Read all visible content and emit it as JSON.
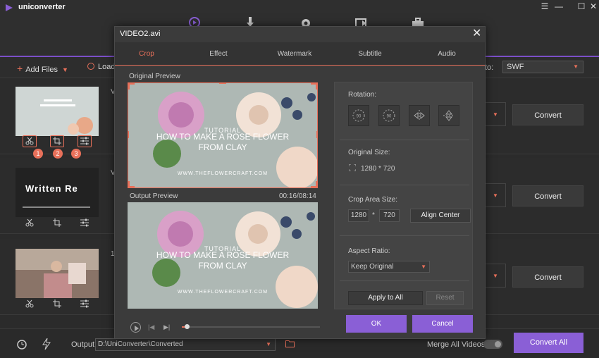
{
  "app": {
    "title": "uniconverter",
    "window_controls": [
      "☰",
      "—",
      "☐",
      "✕"
    ]
  },
  "toolbar": {
    "add_files": "Add Files",
    "load_dvd": "Load",
    "convert_to_label": "to:",
    "format": "SWF"
  },
  "files": [
    {
      "letter": "V",
      "thumb_text": "",
      "convert_label": "Convert",
      "badges": [
        "1",
        "2",
        "3"
      ]
    },
    {
      "letter": "V",
      "thumb_text": "Written Re",
      "convert_label": "Convert"
    },
    {
      "letter": "1",
      "thumb_text": "",
      "convert_label": "Convert"
    }
  ],
  "footer": {
    "output_label": "Output",
    "output_path": "D:\\UniConverter\\Converted",
    "merge_label": "Merge All Videos",
    "convert_all": "Convert All"
  },
  "dialog": {
    "title": "VIDEO2.avi",
    "tabs": [
      "Crop",
      "Effect",
      "Watermark",
      "Subtitle",
      "Audio"
    ],
    "active_tab": "Crop",
    "original_preview_label": "Original Preview",
    "output_preview_label": "Output Preview",
    "time": "00:16/08:14",
    "video_text": {
      "line1": "TUTORIAL",
      "line2": "HOW TO MAKE A ROSE FLOWER",
      "line3": "FROM CLAY",
      "line4": "WWW.THEFLOWERCRAFT.COM"
    },
    "seek_progress": 0.02,
    "rotation_label": "Rotation:",
    "rotation_buttons": [
      "90",
      "90"
    ],
    "original_size_label": "Original Size:",
    "original_size": "1280 * 720",
    "crop_area_label": "Crop Area Size:",
    "crop_width": "1280",
    "crop_separator": "*",
    "crop_height": "720",
    "align_center": "Align Center",
    "aspect_ratio_label": "Aspect Ratio:",
    "aspect_ratio_value": "Keep Original",
    "apply_to_all": "Apply to All",
    "reset": "Reset",
    "ok": "OK",
    "cancel": "Cancel"
  },
  "colors": {
    "accent": "#e8705a",
    "purple": "#8a5fd6",
    "background": "#2b2b2b"
  }
}
